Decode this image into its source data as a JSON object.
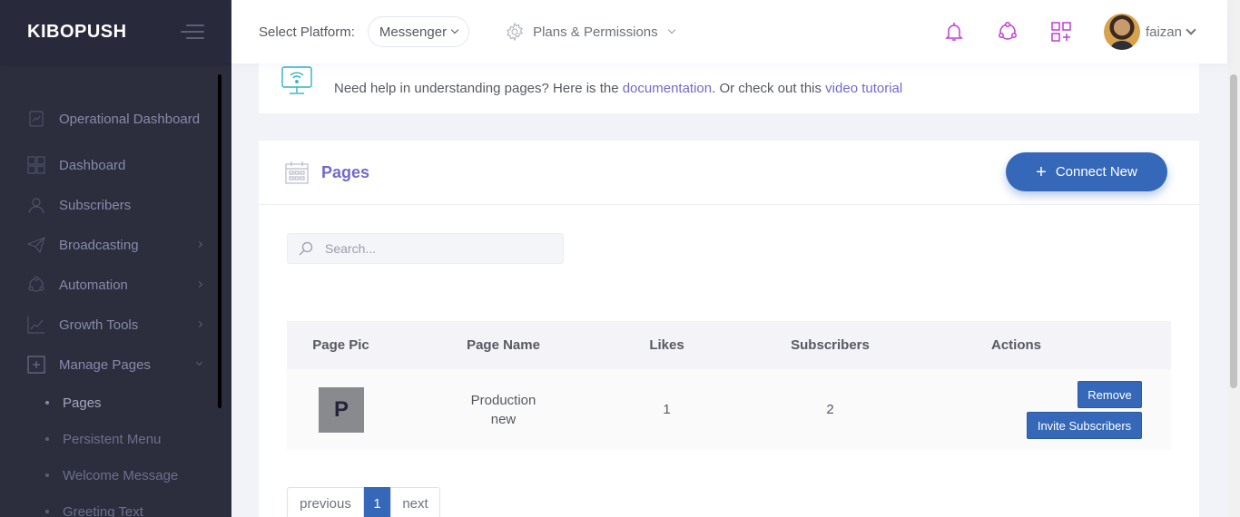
{
  "sidebar": {
    "brand": "KIBOPUSH",
    "items": [
      {
        "label": "Operational Dashboard",
        "icon": "operational-dashboard-icon"
      },
      {
        "label": "Dashboard",
        "icon": "dashboard-grid-icon"
      },
      {
        "label": "Subscribers",
        "icon": "subscribers-icon"
      },
      {
        "label": "Broadcasting",
        "icon": "paper-plane-icon"
      },
      {
        "label": "Automation",
        "icon": "automation-icon"
      },
      {
        "label": "Growth Tools",
        "icon": "growth-chart-icon"
      },
      {
        "label": "Manage Pages",
        "icon": "manage-pages-icon"
      }
    ],
    "subitems": [
      "Pages",
      "Persistent Menu",
      "Welcome Message",
      "Greeting Text"
    ]
  },
  "header": {
    "platform_label": "Select Platform:",
    "platform_value": "Messenger",
    "plans_label": "Plans & Permissions",
    "username": "faizan"
  },
  "help": {
    "prefix": "Need help in understanding pages? Here is the ",
    "doc_link": "documentation",
    "middle": ". Or check out this ",
    "video_link": "video tutorial"
  },
  "pages": {
    "title": "Pages",
    "connect_label": "Connect New",
    "search_placeholder": "Search...",
    "columns": [
      "Page Pic",
      "Page Name",
      "Likes",
      "Subscribers",
      "Actions"
    ],
    "rows": [
      {
        "pic_letter": "P",
        "name": "Production new",
        "likes": "1",
        "subscribers": "2",
        "remove_label": "Remove",
        "invite_label": "Invite Subscribers"
      }
    ],
    "pager": {
      "prev": "previous",
      "current": "1",
      "next": "next"
    }
  },
  "colors": {
    "sidebar_bg": "#2c2e3e",
    "accent_purple": "#716aca",
    "primary_blue": "#3568b8",
    "header_icon": "#c13bd6"
  }
}
